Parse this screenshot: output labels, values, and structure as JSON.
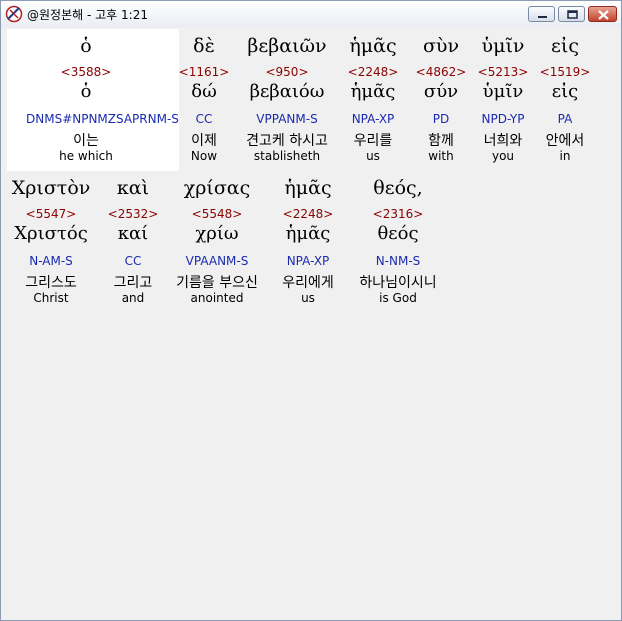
{
  "window": {
    "title": "@원정본해 - 고후 1:21"
  },
  "rows": [
    [
      {
        "greek": "ὁ",
        "strong": "<3588>",
        "lemma": "ὁ",
        "parsing": "DNMS#NPNMZSAPRNM-S",
        "korean": "이는",
        "english": "he which"
      },
      {
        "greek": "δὲ",
        "strong": "<1161>",
        "lemma": "δώ",
        "parsing": "CC",
        "korean": "이제",
        "english": "Now"
      },
      {
        "greek": "βεβαιῶν",
        "strong": "<950>",
        "lemma": "βεβαιόω",
        "parsing": "VPPANM-S",
        "korean": "견고케 하시고",
        "english": "stablisheth"
      },
      {
        "greek": "ἡμᾶς",
        "strong": "<2248>",
        "lemma": "ἡμᾶς",
        "parsing": "NPA-XP",
        "korean": "우리를",
        "english": "us"
      },
      {
        "greek": "σὺν",
        "strong": "<4862>",
        "lemma": "σύν",
        "parsing": "PD",
        "korean": "함께",
        "english": "with"
      },
      {
        "greek": "ὑμῖν",
        "strong": "<5213>",
        "lemma": "ὑμῖν",
        "parsing": "NPD-YP",
        "korean": "너희와",
        "english": "you"
      },
      {
        "greek": "εἰς",
        "strong": "<1519>",
        "lemma": "εἰς",
        "parsing": "PA",
        "korean": "안에서",
        "english": "in"
      }
    ],
    [
      {
        "greek": "Χριστὸν",
        "strong": "<5547>",
        "lemma": "Χριστός",
        "parsing": "N-AM-S",
        "korean": "그리스도",
        "english": "Christ"
      },
      {
        "greek": "καὶ",
        "strong": "<2532>",
        "lemma": "καί",
        "parsing": "CC",
        "korean": "그리고",
        "english": "and"
      },
      {
        "greek": "χρίσας",
        "strong": "<5548>",
        "lemma": "χρίω",
        "parsing": "VPAANM-S",
        "korean": "기름을 부으신",
        "english": "anointed"
      },
      {
        "greek": "ἡμᾶς",
        "strong": "<2248>",
        "lemma": "ἡμᾶς",
        "parsing": "NPA-XP",
        "korean": "우리에게",
        "english": "us"
      },
      {
        "greek": "θεός,",
        "strong": "<2316>",
        "lemma": "θεός",
        "parsing": "N-NM-S",
        "korean": "하나님이시니",
        "english": "is God"
      }
    ]
  ]
}
